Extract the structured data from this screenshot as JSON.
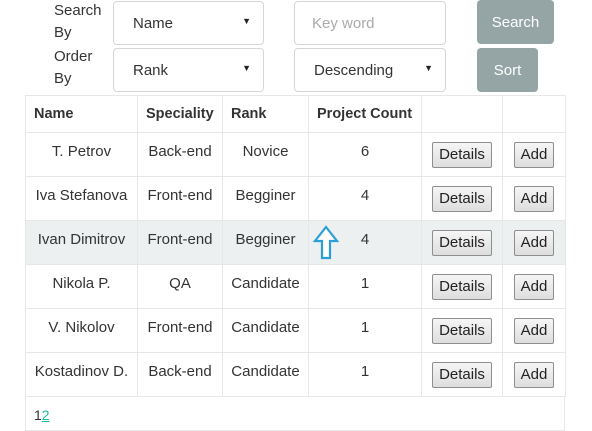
{
  "controls": {
    "search_label": "Search By",
    "search_by_value": "Name",
    "keyword_placeholder": "Key word",
    "search_button": "Search",
    "order_label": "Order By",
    "order_by_value": "Rank",
    "order_direction_value": "Descending",
    "sort_button": "Sort"
  },
  "table": {
    "headers": [
      "Name",
      "Speciality",
      "Rank",
      "Project Count",
      "",
      ""
    ],
    "details_label": "Details",
    "add_label": "Add",
    "rows": [
      {
        "name": "T. Petrov",
        "speciality": "Back-end",
        "rank": "Novice",
        "project_count": "6"
      },
      {
        "name": "Iva Stefanova",
        "speciality": "Front-end",
        "rank": "Begginer",
        "project_count": "4"
      },
      {
        "name": "Ivan Dimitrov",
        "speciality": "Front-end",
        "rank": "Begginer",
        "project_count": "4"
      },
      {
        "name": "Nikola P.",
        "speciality": "QA",
        "rank": "Candidate",
        "project_count": "1"
      },
      {
        "name": "V. Nikolov",
        "speciality": "Front-end",
        "rank": "Candidate",
        "project_count": "1"
      },
      {
        "name": "Kostadinov D.",
        "speciality": "Back-end",
        "rank": "Candidate",
        "project_count": "1"
      }
    ]
  },
  "pagination": {
    "pages": [
      "1",
      "2"
    ],
    "current": "1"
  },
  "colors": {
    "button_bg": "#95a5a6",
    "highlight_row": "#ecf0f1",
    "link": "#18bc9c",
    "cursor": "#2a9fd6"
  }
}
